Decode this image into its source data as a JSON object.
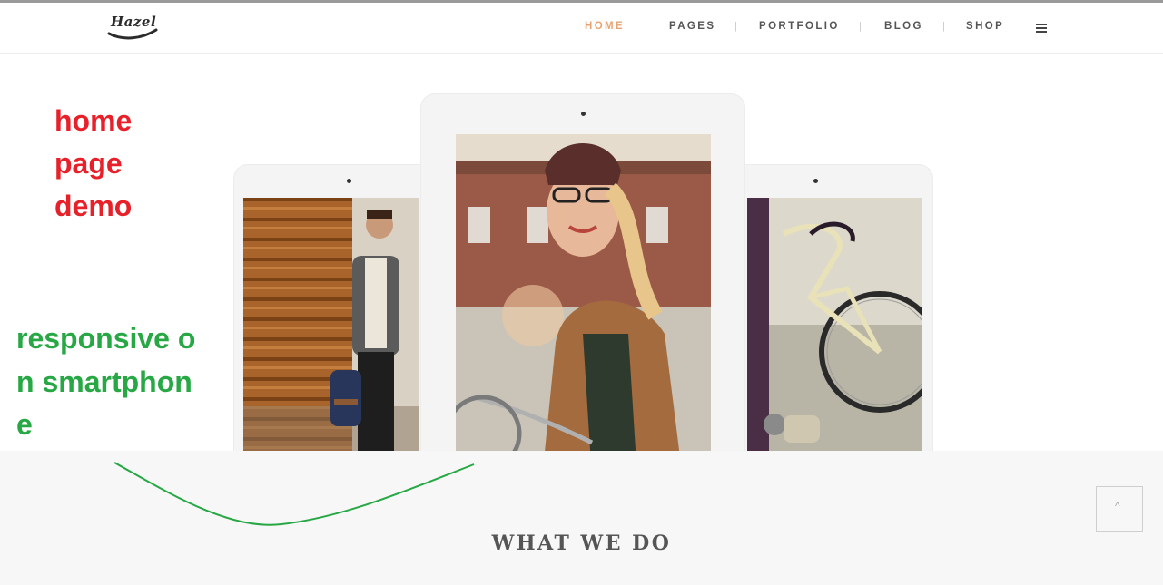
{
  "header": {
    "logo_text": "Hazel",
    "nav": [
      {
        "label": "HOME",
        "active": true
      },
      {
        "label": "PAGES",
        "active": false
      },
      {
        "label": "PORTFOLIO",
        "active": false
      },
      {
        "label": "BLOG",
        "active": false
      },
      {
        "label": "SHOP",
        "active": false
      }
    ],
    "separator": "|",
    "menu_icon": "hamburger-icon"
  },
  "annotations": {
    "red_lines": [
      "home",
      "page",
      "demo"
    ],
    "green_text": "responsive on smartphone",
    "red_color": "#e8202a",
    "green_color": "#27a844"
  },
  "section": {
    "title": "WHAT WE DO"
  },
  "back_to_top": {
    "glyph": "^",
    "icon": "chevron-up-icon"
  },
  "colors": {
    "accent": "#e8a372",
    "nav_text": "#555555",
    "section_bg": "#f7f7f7"
  }
}
